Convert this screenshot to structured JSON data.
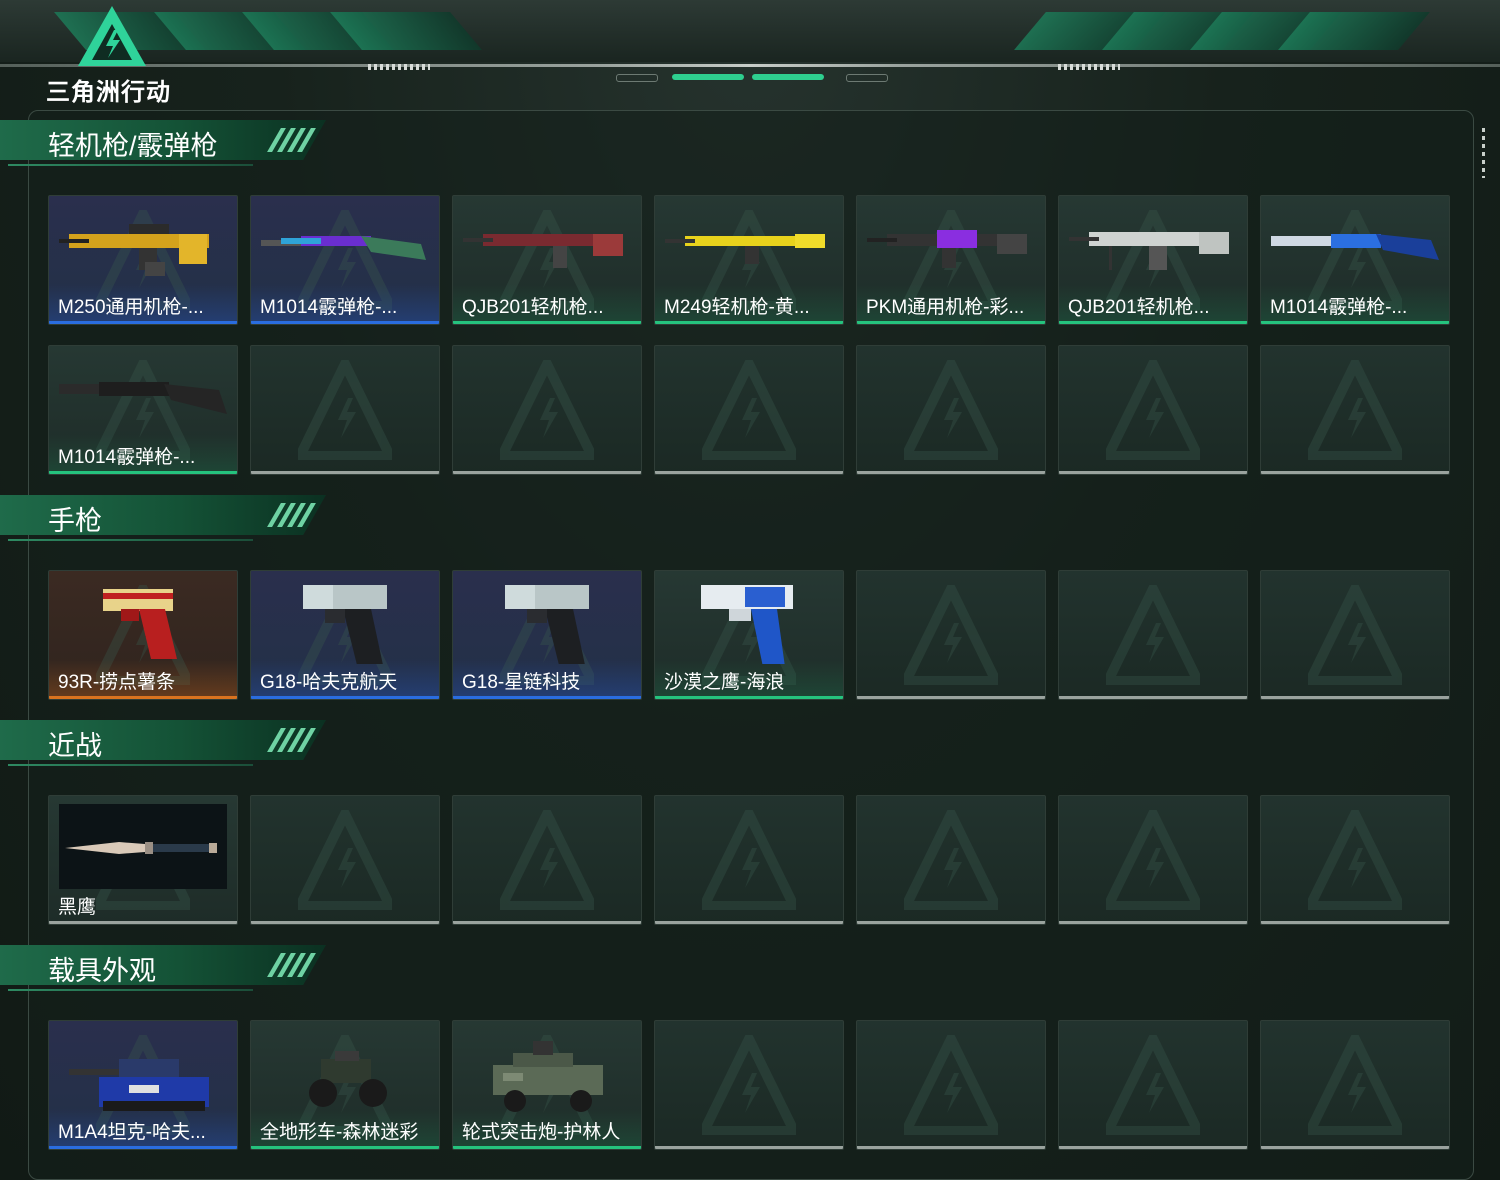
{
  "app": {
    "logo_text": "三角洲行动",
    "logo_icon": "delta-logo-icon"
  },
  "sections": [
    {
      "title": "轻机枪/霰弹枪",
      "items": [
        {
          "label": "M250通用机枪-...",
          "rarity": "blue",
          "icon": "machine-gun-gold-icon"
        },
        {
          "label": "M1014霰弹枪-...",
          "rarity": "blue",
          "icon": "shotgun-purple-icon"
        },
        {
          "label": "QJB201轻机枪...",
          "rarity": "green",
          "icon": "machine-gun-red-icon"
        },
        {
          "label": "M249轻机枪-黄...",
          "rarity": "green",
          "icon": "machine-gun-yellow-icon"
        },
        {
          "label": "PKM通用机枪-彩...",
          "rarity": "green",
          "icon": "machine-gun-purple-icon"
        },
        {
          "label": "QJB201轻机枪...",
          "rarity": "green",
          "icon": "machine-gun-white-icon"
        },
        {
          "label": "M1014霰弹枪-...",
          "rarity": "green",
          "icon": "shotgun-blue-icon"
        },
        {
          "label": "M1014霰弹枪-...",
          "rarity": "green",
          "icon": "shotgun-black-icon"
        },
        {
          "label": "",
          "rarity": "gray"
        },
        {
          "label": "",
          "rarity": "gray"
        },
        {
          "label": "",
          "rarity": "gray"
        },
        {
          "label": "",
          "rarity": "gray"
        },
        {
          "label": "",
          "rarity": "gray"
        },
        {
          "label": "",
          "rarity": "gray"
        }
      ]
    },
    {
      "title": "手枪",
      "items": [
        {
          "label": "93R-捞点薯条",
          "rarity": "orange",
          "icon": "pistol-red-gold-icon"
        },
        {
          "label": "G18-哈夫克航天",
          "rarity": "blue",
          "icon": "pistol-glock-icon"
        },
        {
          "label": "G18-星链科技",
          "rarity": "blue",
          "icon": "pistol-glock-icon"
        },
        {
          "label": "沙漠之鹰-海浪",
          "rarity": "green",
          "icon": "pistol-deagle-icon"
        },
        {
          "label": "",
          "rarity": "gray"
        },
        {
          "label": "",
          "rarity": "gray"
        },
        {
          "label": "",
          "rarity": "gray"
        }
      ]
    },
    {
      "title": "近战",
      "items": [
        {
          "label": "黑鹰",
          "rarity": "gray",
          "icon": "knife-icon"
        },
        {
          "label": "",
          "rarity": "gray"
        },
        {
          "label": "",
          "rarity": "gray"
        },
        {
          "label": "",
          "rarity": "gray"
        },
        {
          "label": "",
          "rarity": "gray"
        },
        {
          "label": "",
          "rarity": "gray"
        },
        {
          "label": "",
          "rarity": "gray"
        }
      ]
    },
    {
      "title": "载具外观",
      "items": [
        {
          "label": "M1A4坦克-哈夫...",
          "rarity": "blue",
          "icon": "tank-icon"
        },
        {
          "label": "全地形车-森林迷彩",
          "rarity": "green",
          "icon": "atv-icon"
        },
        {
          "label": "轮式突击炮-护林人",
          "rarity": "green",
          "icon": "armored-car-icon"
        },
        {
          "label": "",
          "rarity": "gray"
        },
        {
          "label": "",
          "rarity": "gray"
        },
        {
          "label": "",
          "rarity": "gray"
        },
        {
          "label": "",
          "rarity": "gray"
        }
      ]
    }
  ],
  "colors": {
    "accent": "#25c37e",
    "blue": "#2a6de0",
    "orange": "#d9731f",
    "gray": "#9aa39e",
    "panel": "#142019"
  }
}
